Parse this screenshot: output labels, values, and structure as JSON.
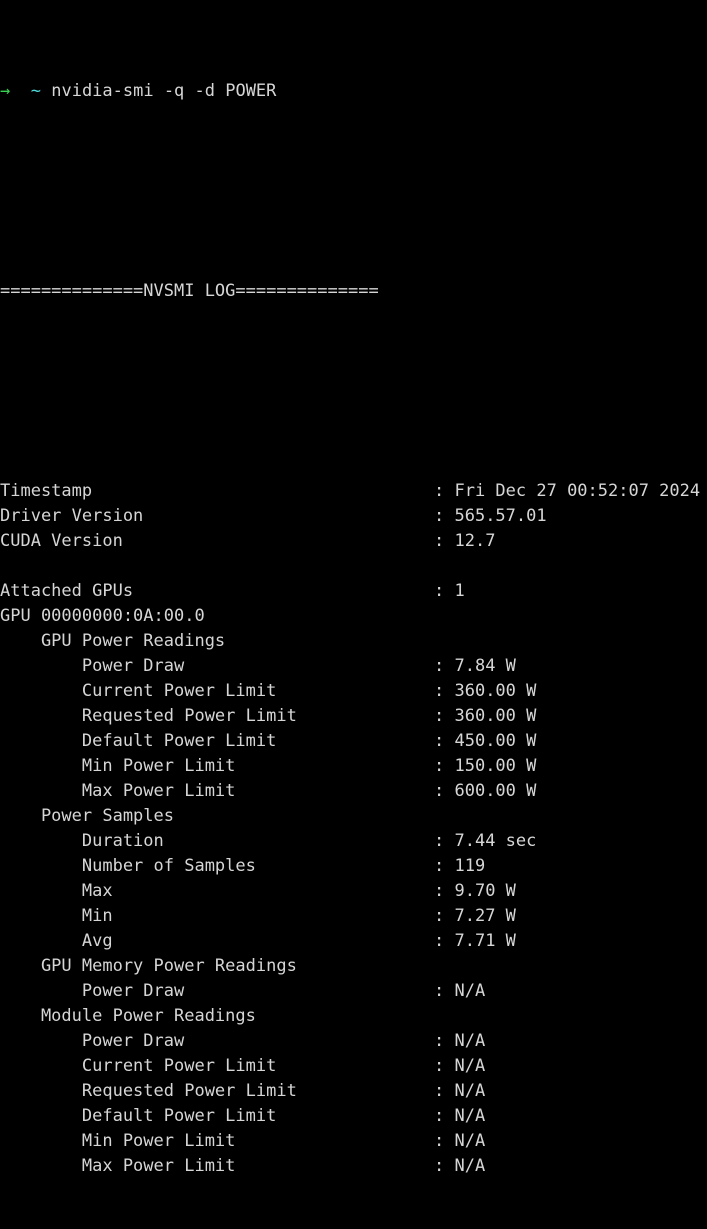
{
  "terminal": {
    "background_color": "#000000",
    "text_color": "#d6d6d6",
    "prompt_arrow_color": "#39d353",
    "prompt_cwd_color": "#4fd6d6",
    "prompt": {
      "arrow": "→",
      "cwd": "~",
      "command": "nvidia-smi -q -d POWER"
    },
    "header_rule": "==============NVSMI LOG==============",
    "separator": ":",
    "entries": [
      {
        "id": "timestamp",
        "indent": 0,
        "label": "Timestamp",
        "value": "Fri Dec 27 00:52:07 2024"
      },
      {
        "id": "driver-version",
        "indent": 0,
        "label": "Driver Version",
        "value": "565.57.01"
      },
      {
        "id": "cuda-version",
        "indent": 0,
        "label": "CUDA Version",
        "value": "12.7"
      },
      {
        "id": "blank-1",
        "indent": 0,
        "label": "",
        "value": null,
        "blank": true
      },
      {
        "id": "attached-gpus",
        "indent": 0,
        "label": "Attached GPUs",
        "value": "1"
      },
      {
        "id": "gpu-id",
        "indent": 0,
        "label": "GPU 00000000:0A:00.0",
        "value": null
      },
      {
        "id": "gpu-power-readings",
        "indent": 4,
        "label": "GPU Power Readings",
        "value": null
      },
      {
        "id": "gpu-power-draw",
        "indent": 8,
        "label": "Power Draw",
        "value": "7.84 W"
      },
      {
        "id": "gpu-current-power-limit",
        "indent": 8,
        "label": "Current Power Limit",
        "value": "360.00 W"
      },
      {
        "id": "gpu-requested-power-limit",
        "indent": 8,
        "label": "Requested Power Limit",
        "value": "360.00 W"
      },
      {
        "id": "gpu-default-power-limit",
        "indent": 8,
        "label": "Default Power Limit",
        "value": "450.00 W"
      },
      {
        "id": "gpu-min-power-limit",
        "indent": 8,
        "label": "Min Power Limit",
        "value": "150.00 W"
      },
      {
        "id": "gpu-max-power-limit",
        "indent": 8,
        "label": "Max Power Limit",
        "value": "600.00 W"
      },
      {
        "id": "power-samples",
        "indent": 4,
        "label": "Power Samples",
        "value": null
      },
      {
        "id": "samples-duration",
        "indent": 8,
        "label": "Duration",
        "value": "7.44 sec"
      },
      {
        "id": "samples-number",
        "indent": 8,
        "label": "Number of Samples",
        "value": "119"
      },
      {
        "id": "samples-max",
        "indent": 8,
        "label": "Max",
        "value": "9.70 W"
      },
      {
        "id": "samples-min",
        "indent": 8,
        "label": "Min",
        "value": "7.27 W"
      },
      {
        "id": "samples-avg",
        "indent": 8,
        "label": "Avg",
        "value": "7.71 W"
      },
      {
        "id": "gpu-memory-power-readings",
        "indent": 4,
        "label": "GPU Memory Power Readings",
        "value": null
      },
      {
        "id": "gpu-memory-power-draw",
        "indent": 8,
        "label": "Power Draw",
        "value": "N/A"
      },
      {
        "id": "module-power-readings",
        "indent": 4,
        "label": "Module Power Readings",
        "value": null
      },
      {
        "id": "module-power-draw",
        "indent": 8,
        "label": "Power Draw",
        "value": "N/A"
      },
      {
        "id": "module-current-power-limit",
        "indent": 8,
        "label": "Current Power Limit",
        "value": "N/A"
      },
      {
        "id": "module-requested-power-limit",
        "indent": 8,
        "label": "Requested Power Limit",
        "value": "N/A"
      },
      {
        "id": "module-default-power-limit",
        "indent": 8,
        "label": "Default Power Limit",
        "value": "N/A"
      },
      {
        "id": "module-min-power-limit",
        "indent": 8,
        "label": "Min Power Limit",
        "value": "N/A"
      },
      {
        "id": "module-max-power-limit",
        "indent": 8,
        "label": "Max Power Limit",
        "value": "N/A"
      }
    ]
  }
}
